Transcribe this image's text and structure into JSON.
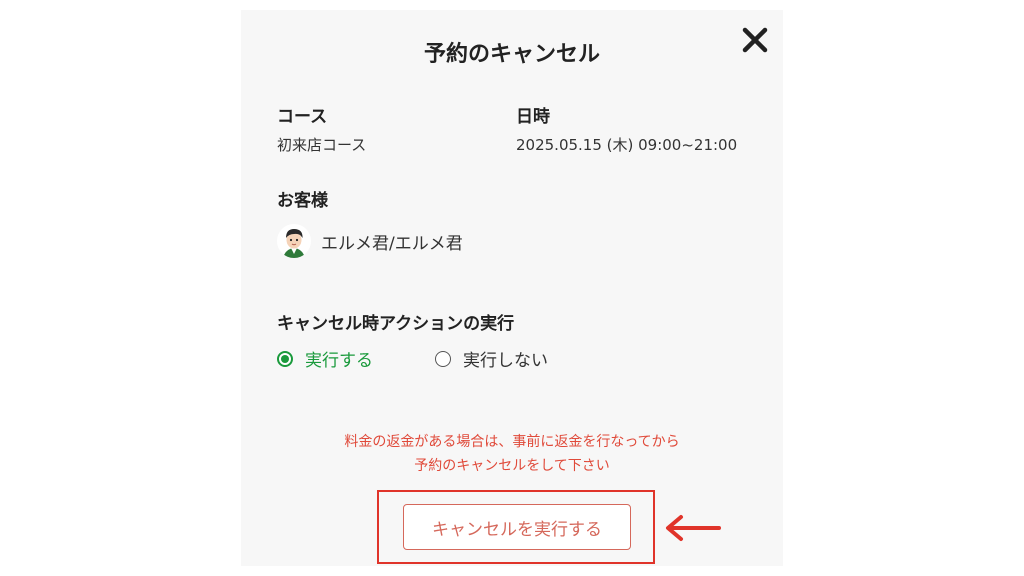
{
  "modal": {
    "title": "予約のキャンセル",
    "close_icon": "close-icon"
  },
  "course": {
    "label": "コース",
    "value": "初来店コース"
  },
  "datetime": {
    "label": "日時",
    "value": "2025.05.15 (木) 09:00~21:00"
  },
  "customer": {
    "label": "お客様",
    "name": "エルメ君/エルメ君",
    "avatar_icon": "avatar"
  },
  "cancel_action": {
    "label": "キャンセル時アクションの実行",
    "options": [
      {
        "label": "実行する",
        "selected": true
      },
      {
        "label": "実行しない",
        "selected": false
      }
    ]
  },
  "warning": {
    "line1": "料金の返金がある場合は、事前に返金を行なってから",
    "line2": "予約のキャンセルをして下さい"
  },
  "submit": {
    "label": "キャンセルを実行する"
  },
  "colors": {
    "accent_green": "#1a9a3c",
    "warning_red": "#e04a3a",
    "button_border": "#d5685b",
    "highlight_red": "#e0342a"
  },
  "annotation": {
    "arrow_icon": "left-arrow-icon"
  }
}
